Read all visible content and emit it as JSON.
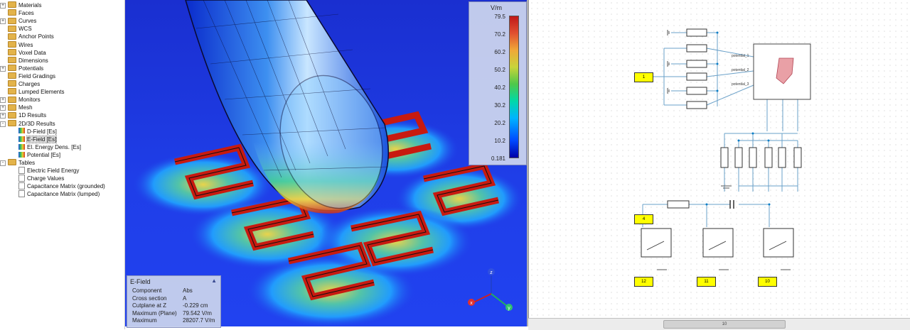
{
  "tree": {
    "items": [
      {
        "label": "Materials",
        "kind": "folder",
        "expander": "+"
      },
      {
        "label": "Faces",
        "kind": "folder",
        "expander": ""
      },
      {
        "label": "Curves",
        "kind": "folder",
        "expander": "+"
      },
      {
        "label": "WCS",
        "kind": "folder",
        "expander": ""
      },
      {
        "label": "Anchor Points",
        "kind": "folder",
        "expander": ""
      },
      {
        "label": "Wires",
        "kind": "folder",
        "expander": ""
      },
      {
        "label": "Voxel Data",
        "kind": "folder",
        "expander": ""
      },
      {
        "label": "Dimensions",
        "kind": "folder",
        "expander": ""
      },
      {
        "label": "Potentials",
        "kind": "folder",
        "expander": "+"
      },
      {
        "label": "Field Gradings",
        "kind": "folder",
        "expander": ""
      },
      {
        "label": "Charges",
        "kind": "folder",
        "expander": ""
      },
      {
        "label": "Lumped Elements",
        "kind": "folder",
        "expander": ""
      },
      {
        "label": "Monitors",
        "kind": "folder",
        "expander": "+"
      },
      {
        "label": "Mesh",
        "kind": "folder",
        "expander": "+"
      },
      {
        "label": "1D Results",
        "kind": "folder",
        "expander": "+"
      },
      {
        "label": "2D/3D Results",
        "kind": "folder",
        "expander": "-"
      },
      {
        "label": "D-Field [Es]",
        "kind": "result",
        "expander": ""
      },
      {
        "label": "E-Field [Es]",
        "kind": "result",
        "expander": "",
        "selected": true
      },
      {
        "label": "El. Energy Dens. [Es]",
        "kind": "result",
        "expander": ""
      },
      {
        "label": "Potential [Es]",
        "kind": "result",
        "expander": ""
      },
      {
        "label": "Tables",
        "kind": "folder",
        "expander": "-"
      },
      {
        "label": "Electric Field Energy",
        "kind": "doc",
        "expander": ""
      },
      {
        "label": "Charge Values",
        "kind": "doc",
        "expander": ""
      },
      {
        "label": "Capacitance Matrix (grounded)",
        "kind": "doc",
        "expander": ""
      },
      {
        "label": "Capacitance Matrix (lumped)",
        "kind": "doc",
        "expander": ""
      }
    ]
  },
  "legend": {
    "unit": "V/m",
    "ticks": [
      "79.5",
      "70.2",
      "60.2",
      "50.2",
      "40.2",
      "30.2",
      "20.2",
      "10.2",
      "0.181"
    ]
  },
  "info": {
    "title": "E-Field",
    "rows": [
      {
        "k": "Component",
        "v": "Abs"
      },
      {
        "k": "Cross section",
        "v": "A"
      },
      {
        "k": "Cutplane at Z",
        "v": "-0.229 cm"
      },
      {
        "k": "Maximum (Plane)",
        "v": "79.542 V/m"
      },
      {
        "k": "Maximum",
        "v": "28207.7 V/m"
      }
    ]
  },
  "axes": {
    "x": "x",
    "y": "y",
    "z": "z"
  },
  "schematic": {
    "labels": {
      "b1": "1",
      "b4": "4",
      "b12": "12",
      "b11": "11",
      "b10": "10"
    },
    "ports": [
      "potential_1",
      "potential_2",
      "potential_3"
    ]
  },
  "scrollbar": {
    "thumb_text": "10"
  },
  "colors": {
    "view_bg": "#1f3ee8",
    "highlight": "#ffff00"
  }
}
